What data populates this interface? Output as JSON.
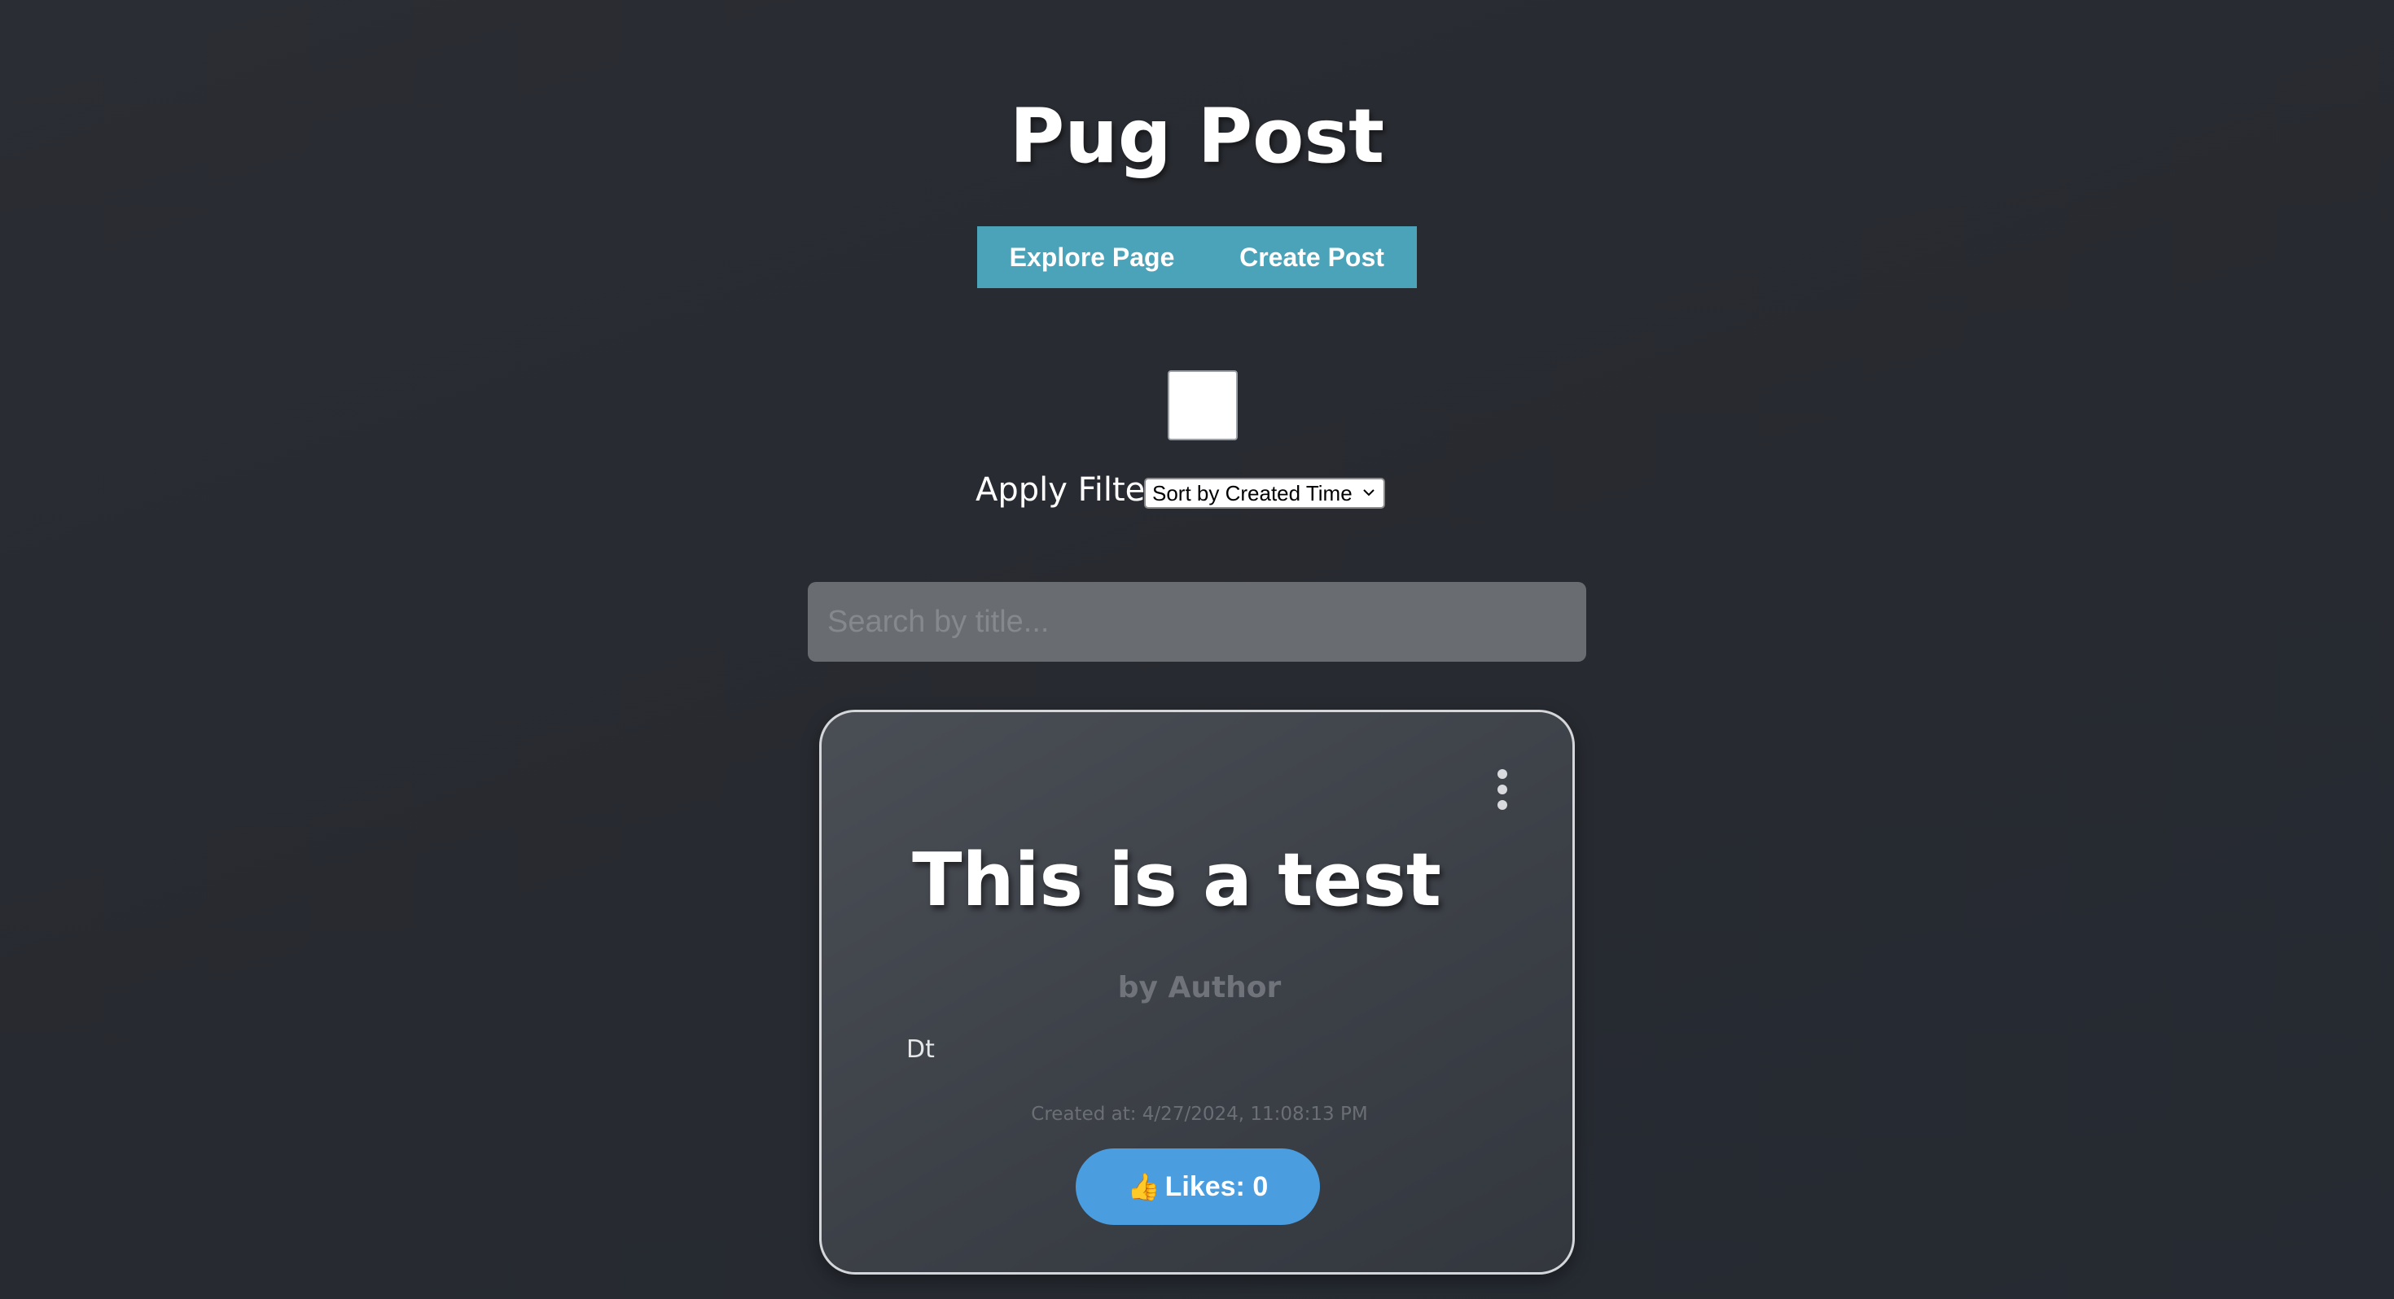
{
  "header": {
    "title": "Pug Post"
  },
  "nav": {
    "explore_label": "Explore Page",
    "create_label": "Create Post"
  },
  "filter": {
    "checked": false,
    "label": "Apply Filter",
    "sort_selected": "Sort by Created Time"
  },
  "search": {
    "placeholder": "Search by title..."
  },
  "post": {
    "title": "This is a test",
    "author": "by Author",
    "body": "Dt",
    "created": "Created at: 4/27/2024, 11:08:13 PM",
    "likes_label": "Likes: 0",
    "likes_icon": "👍"
  },
  "colors": {
    "background": "#282b31",
    "nav_bar": "#4aa3b8",
    "search_bg": "#696c71",
    "likes_button": "#4a9ee0",
    "card_border": "#d4d6d9"
  }
}
